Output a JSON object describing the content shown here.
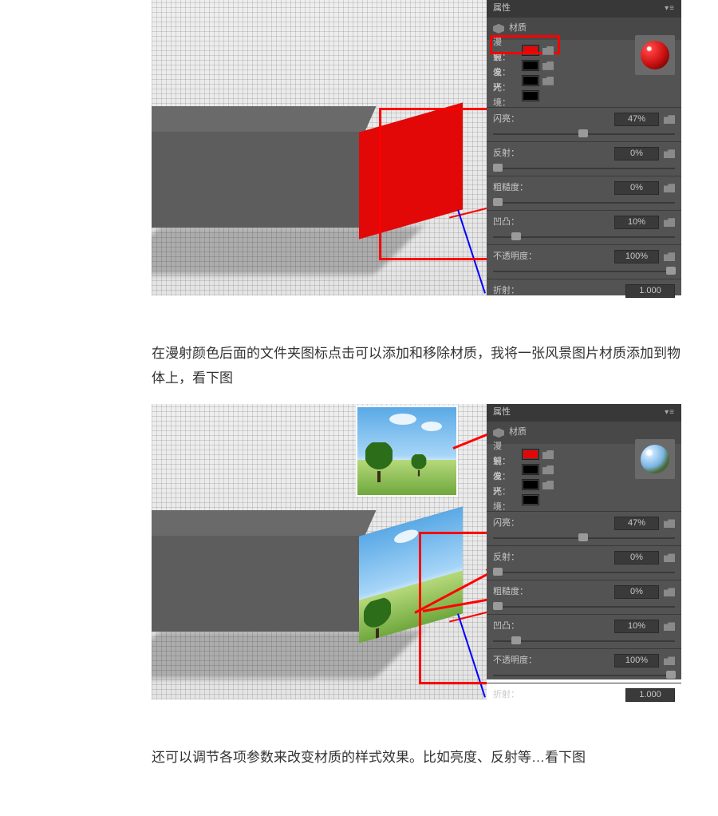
{
  "paragraphs": {
    "p1": "在漫射颜色后面的文件夹图标点击可以添加和移除材质，我将一张风景图片材质添加到物体上，看下图",
    "p2": "还可以调节各项参数来改变材质的样式效果。比如亮度、反射等…看下图"
  },
  "panel": {
    "title": "属性",
    "tab": "材质",
    "labels": {
      "diffuse": "漫射：",
      "specular": "镜像：",
      "glow": "发光：",
      "env": "环境：",
      "shine": "闪亮：",
      "reflect": "反射：",
      "rough": "粗糙度：",
      "bump": "凹凸：",
      "opacity": "不透明度：",
      "ior": "折射："
    },
    "values": {
      "shine": "47%",
      "reflect": "0%",
      "rough": "0%",
      "bump": "10%",
      "opacity": "100%",
      "ior": "1.000"
    }
  }
}
